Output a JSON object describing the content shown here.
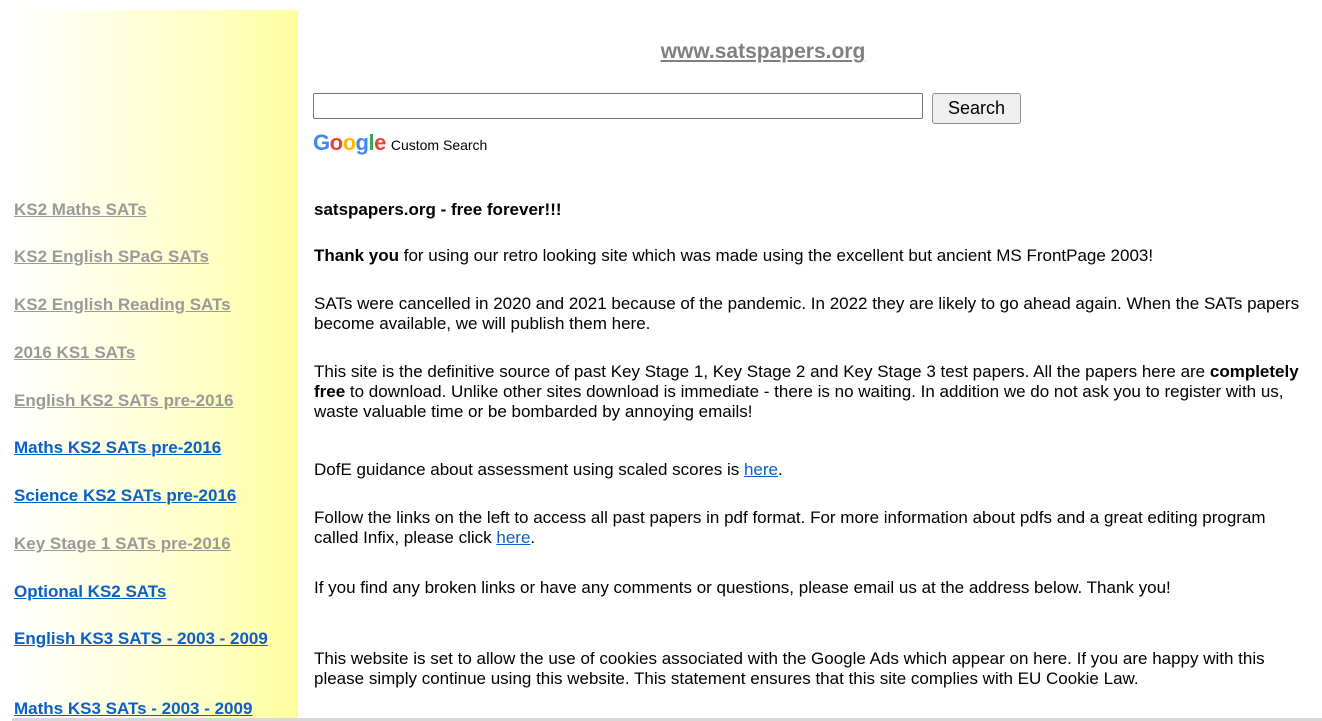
{
  "header": {
    "site_title": "www.satspapers.org"
  },
  "search": {
    "value": "",
    "placeholder": "",
    "button_label": "Search",
    "brand": {
      "letters": [
        "G",
        "o",
        "o",
        "g",
        "l",
        "e"
      ],
      "caption": "Custom Search"
    }
  },
  "sidebar": {
    "items": [
      {
        "label": "KS2 Maths SATs",
        "color": "#9a9a9a"
      },
      {
        "label": "KS2 English SPaG SATs",
        "color": "#9a9a9a"
      },
      {
        "label": "KS2 English Reading SATs",
        "color": "#9a9a9a"
      },
      {
        "label": "2016 KS1 SATs",
        "color": "#9a9a9a"
      },
      {
        "label": "English KS2 SATs pre-2016",
        "color": "#9a9a9a"
      },
      {
        "label": "Maths KS2 SATs pre-2016",
        "color": "#0b5fc7"
      },
      {
        "label": "Science KS2 SATs pre-2016",
        "color": "#0b5fc7"
      },
      {
        "label": "Key Stage 1 SATs pre-2016",
        "color": "#9a9a9a"
      },
      {
        "label": "Optional KS2 SATs",
        "color": "#0b5fc7"
      },
      {
        "label": "English KS3 SATS - 2003 - 2009",
        "color": "#0b5fc7"
      },
      {
        "label": "Maths KS3 SATs - 2003 - 2009",
        "color": "#0b5fc7"
      }
    ]
  },
  "main": {
    "tagline": "satspapers.org - free forever!!!",
    "thanks": {
      "bold": "Thank you",
      "rest": " for using our retro looking site which was made using the excellent but ancient MS FrontPage 2003!"
    },
    "cancelled": "SATs were cancelled in 2020 and 2021 because of the pandemic.  In 2022 they are likely to go ahead again.  When the SATs papers become available, we will publish them here.",
    "definitive": {
      "before": "This site is the definitive source of past Key Stage 1, Key Stage 2 and Key Stage 3 test papers.  All the papers here are ",
      "bold": "completely free",
      "after": " to download. Unlike other sites download is immediate -  there is no waiting.  In addition we do not ask you to register with us, waste valuable time or be bombarded by annoying emails!"
    },
    "dofe": {
      "before": "DofE guidance about assessment using scaled scores is ",
      "link": "here",
      "after": "."
    },
    "follow": {
      "before": "Follow the links on the left to access all past papers in pdf format.  For more information about pdfs and a great editing program called Infix, please click ",
      "link": "here",
      "after": "."
    },
    "broken": "If you find any broken links or have any comments or questions, please email us at the address below.  Thank you!",
    "cookies": "This website is set to allow the use of cookies associated with the Google Ads which appear on here.  If you are happy with this please simply continue using this website. This statement ensures that this site complies with EU Cookie Law."
  },
  "colors": {
    "nav_grey": "#9a9a9a",
    "nav_blue": "#0b5fc7",
    "title_grey": "#808080",
    "sidebar_yellow": "#ffff9e"
  }
}
